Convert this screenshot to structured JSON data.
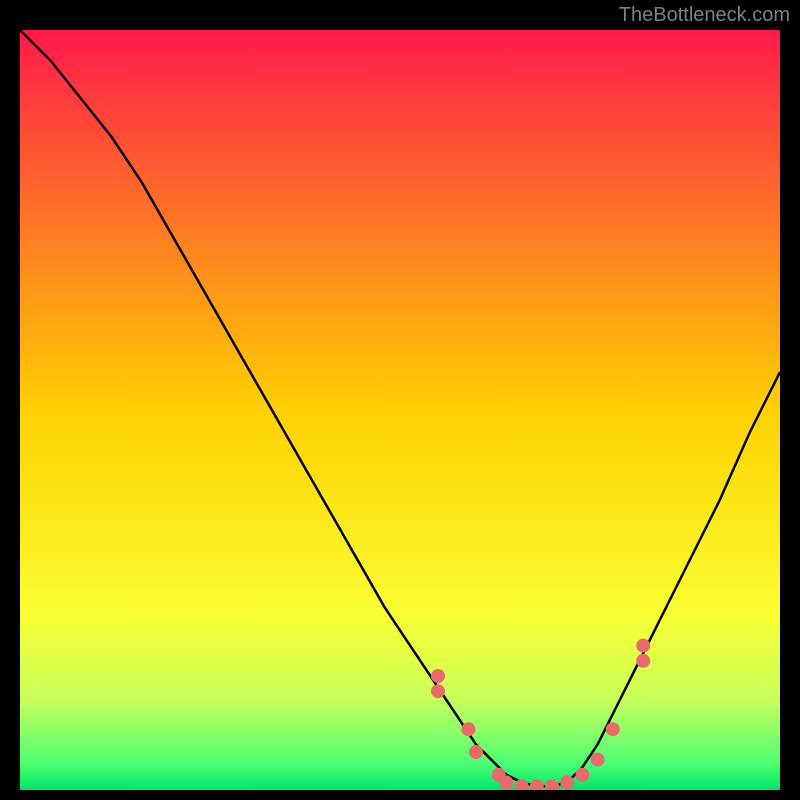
{
  "watermark": "TheBottleneck.com",
  "chart_data": {
    "type": "line",
    "title": "",
    "xlabel": "",
    "ylabel": "",
    "xlim": [
      0,
      100
    ],
    "ylim": [
      0,
      100
    ],
    "grid": false,
    "background_gradient": {
      "stops": [
        {
          "pos": 0.0,
          "color": "#ff1a4a"
        },
        {
          "pos": 0.5,
          "color": "#ffd000"
        },
        {
          "pos": 0.77,
          "color": "#f9ff33"
        },
        {
          "pos": 0.88,
          "color": "#c8ff5a"
        },
        {
          "pos": 0.965,
          "color": "#4dff73"
        },
        {
          "pos": 1.0,
          "color": "#00e46a"
        }
      ]
    },
    "series": [
      {
        "name": "bottleneck-curve",
        "x": [
          0,
          4,
          8,
          12,
          16,
          20,
          24,
          28,
          32,
          36,
          40,
          44,
          48,
          52,
          56,
          58,
          60,
          62,
          64,
          66,
          68,
          70,
          72,
          74,
          76,
          78,
          80,
          84,
          88,
          92,
          96,
          100
        ],
        "y": [
          100,
          96,
          91,
          86,
          80,
          73,
          66,
          59,
          52,
          45,
          38,
          31,
          24,
          18,
          12,
          9,
          6,
          4,
          2,
          1,
          0.5,
          0.5,
          1,
          3,
          6,
          10,
          14,
          22,
          30,
          38,
          47,
          55
        ],
        "stroke": "#000000",
        "stroke_width": 2.5
      }
    ],
    "markers": {
      "name": "highlight-dots",
      "x": [
        55,
        55,
        59,
        60,
        63,
        64,
        66,
        68,
        70,
        72,
        74,
        76,
        78,
        82,
        82
      ],
      "y": [
        15,
        13,
        8,
        5,
        2,
        1,
        0.5,
        0.5,
        0.5,
        1,
        2,
        4,
        8,
        17,
        19
      ],
      "color": "#e96a6a",
      "radius": 7
    }
  }
}
